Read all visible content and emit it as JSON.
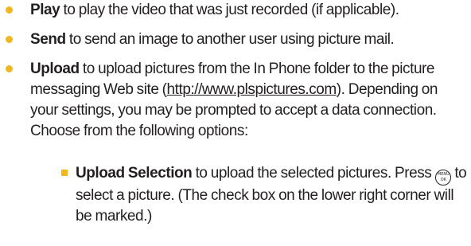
{
  "colors": {
    "bullet": "#f2b71d",
    "text": "#231f20"
  },
  "items": [
    {
      "term": "Play",
      "text": "to play the video that was just recorded (if applicable)."
    },
    {
      "term": "Send",
      "text": "to send an image to another user using picture mail."
    },
    {
      "term": "Upload",
      "text_before_link": "to upload pictures from the In Phone folder to the picture messaging Web site (",
      "link": "http://www.plspictures.com",
      "text_after_link": "). Depending on your settings, you may be prompted to accept a data connection. Choose from the following options:"
    }
  ],
  "subitems": [
    {
      "term": "Upload Selection",
      "text_before_icon": "to upload the selected pictures. Press",
      "icon": "menu-ok-key-icon",
      "icon_top": "MENU",
      "icon_bottom": "OK",
      "text_after_icon": "to select a picture. (The check box on the lower right corner will be marked.)"
    }
  ]
}
